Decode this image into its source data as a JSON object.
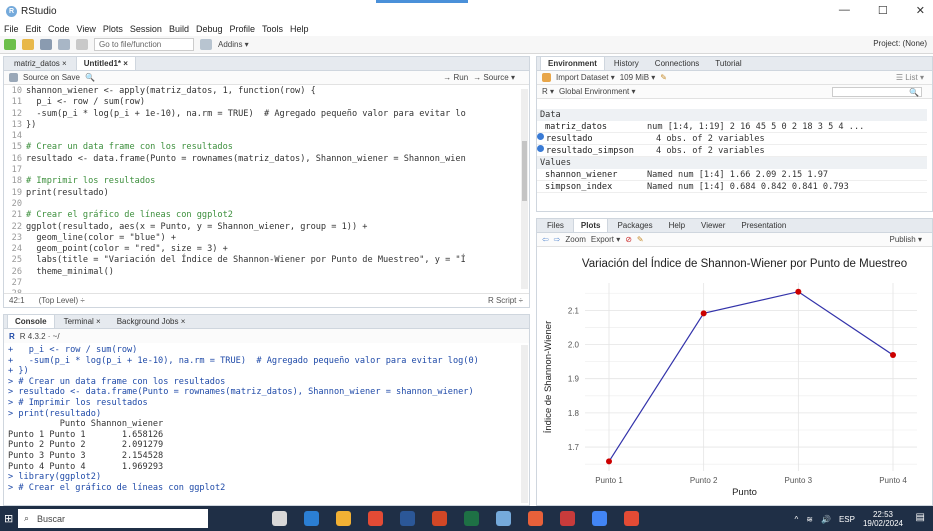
{
  "window": {
    "title": "RStudio",
    "min": "—",
    "max": "☐",
    "close": "✕"
  },
  "menu": [
    "File",
    "Edit",
    "Code",
    "View",
    "Plots",
    "Session",
    "Build",
    "Debug",
    "Profile",
    "Tools",
    "Help"
  ],
  "toolbar": {
    "goto_placeholder": "Go to file/function",
    "addins": "Addins ▾",
    "project": "Project: (None)"
  },
  "editor": {
    "tabs": [
      "matriz_datos ×",
      "Untitled1* ×"
    ],
    "source_on_save": "Source on Save",
    "run": "→ Run",
    "source": "→ Source ▾",
    "lines": [
      {
        "n": "10",
        "t": "shannon_wiener <- apply(matriz_datos, 1, function(row) {"
      },
      {
        "n": "11",
        "t": "  p_i <- row / sum(row)"
      },
      {
        "n": "12",
        "t": "  -sum(p_i * log(p_i + 1e-10), na.rm = TRUE)  # Agregado pequeño valor para evitar lo"
      },
      {
        "n": "13",
        "t": "})"
      },
      {
        "n": "14",
        "t": ""
      },
      {
        "n": "15",
        "t": "# Crear un data frame con los resultados"
      },
      {
        "n": "16",
        "t": "resultado <- data.frame(Punto = rownames(matriz_datos), Shannon_wiener = Shannon_wien"
      },
      {
        "n": "17",
        "t": ""
      },
      {
        "n": "18",
        "t": "# Imprimir los resultados"
      },
      {
        "n": "19",
        "t": "print(resultado)"
      },
      {
        "n": "20",
        "t": ""
      },
      {
        "n": "21",
        "t": "# Crear el gráfico de líneas con ggplot2"
      },
      {
        "n": "22",
        "t": "ggplot(resultado, aes(x = Punto, y = Shannon_wiener, group = 1)) +"
      },
      {
        "n": "23",
        "t": "  geom_line(color = \"blue\") +"
      },
      {
        "n": "24",
        "t": "  geom_point(color = \"red\", size = 3) +"
      },
      {
        "n": "25",
        "t": "  labs(title = \"Variación del Índice de Shannon-Wiener por Punto de Muestreo\", y = \"Í"
      },
      {
        "n": "26",
        "t": "  theme_minimal()"
      },
      {
        "n": "27",
        "t": ""
      },
      {
        "n": "28",
        "t": ""
      }
    ],
    "status_pos": "42:1",
    "status_scope": "(Top Level) ÷",
    "status_type": "R Script ÷"
  },
  "console": {
    "tabs": [
      "Console",
      "Terminal ×",
      "Background Jobs ×"
    ],
    "version": "R 4.3.2 · ~/",
    "lines": [
      {
        "t": "+   p_i <- row / sum(row)",
        "c": "blue"
      },
      {
        "t": "+   -sum(p_i * log(p_i + 1e-10), na.rm = TRUE)  # Agregado pequeño valor para evitar log(0)",
        "c": "blue"
      },
      {
        "t": "+ })",
        "c": "blue"
      },
      {
        "t": "> # Crear un data frame con los resultados",
        "c": "blue"
      },
      {
        "t": "> resultado <- data.frame(Punto = rownames(matriz_datos), Shannon_wiener = shannon_wiener)",
        "c": "blue"
      },
      {
        "t": "> # Imprimir los resultados",
        "c": "blue"
      },
      {
        "t": "> print(resultado)",
        "c": "blue"
      },
      {
        "t": "          Punto Shannon_wiener",
        "c": ""
      },
      {
        "t": "Punto 1 Punto 1       1.658126",
        "c": ""
      },
      {
        "t": "Punto 2 Punto 2       2.091279",
        "c": ""
      },
      {
        "t": "Punto 3 Punto 3       2.154528",
        "c": ""
      },
      {
        "t": "Punto 4 Punto 4       1.969293",
        "c": ""
      },
      {
        "t": "> library(ggplot2)",
        "c": "blue"
      },
      {
        "t": "> # Crear el gráfico de líneas con ggplot2",
        "c": "blue"
      }
    ]
  },
  "environment": {
    "tabs": [
      "Environment",
      "History",
      "Connections",
      "Tutorial"
    ],
    "import": "Import Dataset ▾",
    "memory": "109 MiB ▾",
    "list": "☰ List ▾",
    "lang": "R ▾",
    "global": "Global Environment ▾",
    "data_header": "Data",
    "values_header": "Values",
    "data_rows": [
      {
        "name": "matriz_datos",
        "value": "num [1:4, 1:19] 2 16 45 5 0 2 18 3 5 4 ...",
        "dot": false
      },
      {
        "name": "resultado",
        "value": "4 obs. of 2 variables",
        "dot": true
      },
      {
        "name": "resultado_simpson",
        "value": "4 obs. of 2 variables",
        "dot": true
      }
    ],
    "value_rows": [
      {
        "name": "shannon_wiener",
        "value": "Named num [1:4] 1.66 2.09 2.15 1.97"
      },
      {
        "name": "simpson_index",
        "value": "Named num [1:4] 0.684 0.842 0.841 0.793"
      }
    ]
  },
  "plots": {
    "tabs": [
      "Files",
      "Plots",
      "Packages",
      "Help",
      "Viewer",
      "Presentation"
    ],
    "zoom": "Zoom",
    "export": "Export ▾",
    "publish": "Publish ▾"
  },
  "chart_data": {
    "type": "line",
    "title": "Variación del Índice de Shannon-Wiener por Punto de Muestreo",
    "xlabel": "Punto",
    "ylabel": "Índice de Shannon-Wiener",
    "categories": [
      "Punto 1",
      "Punto 2",
      "Punto 3",
      "Punto 4"
    ],
    "values": [
      1.658126,
      2.091279,
      2.154528,
      1.969293
    ],
    "yticks": [
      1.7,
      1.8,
      1.9,
      2.0,
      2.1
    ],
    "ytick_labels": [
      "1.7",
      "1.8",
      "1.9",
      "2.0",
      "2.1"
    ],
    "ylim": [
      1.63,
      2.18
    ],
    "line_color": "#3333aa",
    "point_color": "#cc0000",
    "grid": true
  },
  "taskbar": {
    "search": "Buscar",
    "lang": "ESP",
    "time": "22:53",
    "date": "19/02/2024"
  }
}
